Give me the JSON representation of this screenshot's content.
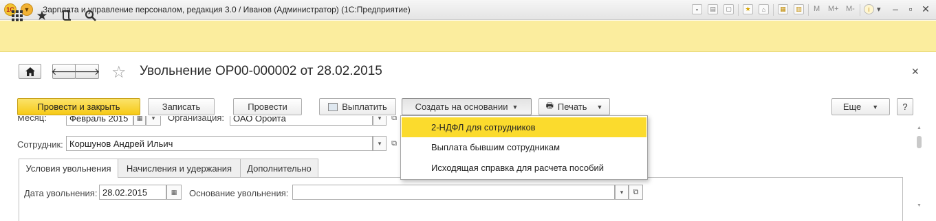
{
  "window": {
    "title": "Зарплата и управление персоналом, редакция 3.0 / Иванов (Администратор)  (1С:Предприятие)",
    "logo": "1С",
    "memory_buttons": [
      "M",
      "M+",
      "M-"
    ]
  },
  "toolbar": {
    "icons": [
      "apps-grid-icon",
      "star-icon",
      "history-icon",
      "search-icon"
    ]
  },
  "form": {
    "title": "Увольнение ОР00-000002 от 28.02.2015"
  },
  "commands": {
    "post_close": "Провести и закрыть",
    "save": "Записать",
    "post": "Провести",
    "pay": "Выплатить",
    "create_based": "Создать на основании",
    "print": "Печать",
    "more": "Еще",
    "help": "?"
  },
  "fields": {
    "month_label": "Месяц:",
    "month_value": "Февраль 2015",
    "org_label": "Организация:",
    "org_value": "ОАО Оройта",
    "employee_label": "Сотрудник:",
    "employee_value": "Коршунов Андрей Ильич"
  },
  "tabs": [
    {
      "label": "Условия увольнения",
      "active": true
    },
    {
      "label": "Начисления и удержания",
      "active": false
    },
    {
      "label": "Дополнительно",
      "active": false
    }
  ],
  "dismissal": {
    "date_label": "Дата увольнения:",
    "date_value": "28.02.2015",
    "reason_label": "Основание увольнения:",
    "reason_value": ""
  },
  "dropdown": {
    "items": [
      {
        "label": "2-НДФЛ для сотрудников",
        "selected": true
      },
      {
        "label": "Выплата бывшим сотрудникам",
        "selected": false
      },
      {
        "label": "Исходящая справка для расчета пособий",
        "selected": false
      }
    ]
  },
  "colors": {
    "toolbar_yellow": "#fbed9e",
    "primary_button": "#f6c915",
    "dropdown_selected": "#fbdb2d"
  }
}
